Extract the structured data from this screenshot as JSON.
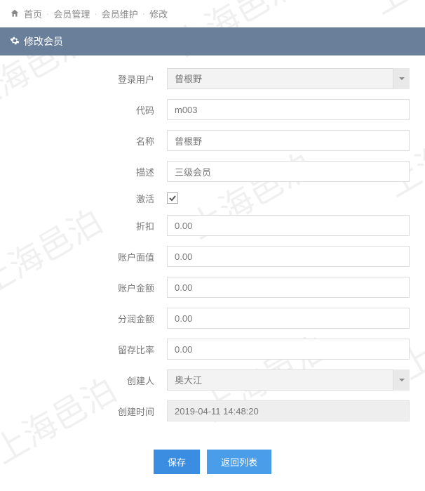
{
  "watermark_text": "上海邑泊",
  "breadcrumb": {
    "home": "首页",
    "level1": "会员管理",
    "level2": "会员维护",
    "current": "修改"
  },
  "panel": {
    "title": "修改会员"
  },
  "form": {
    "login_user": {
      "label": "登录用户",
      "value": "曾根野"
    },
    "code": {
      "label": "代码",
      "value": "m003"
    },
    "name": {
      "label": "名称",
      "value": "曾根野"
    },
    "desc": {
      "label": "描述",
      "value": "三级会员"
    },
    "active": {
      "label": "激活",
      "checked": true
    },
    "discount": {
      "label": "折扣",
      "value": "0.00"
    },
    "face_value": {
      "label": "账户面值",
      "value": "0.00"
    },
    "balance": {
      "label": "账户金额",
      "value": "0.00"
    },
    "dividend": {
      "label": "分润金额",
      "value": "0.00"
    },
    "retention": {
      "label": "留存比率",
      "value": "0.00"
    },
    "creator": {
      "label": "创建人",
      "value": "奥大江"
    },
    "created_at": {
      "label": "创建时间",
      "value": "2019-04-11 14:48:20"
    }
  },
  "actions": {
    "save": "保存",
    "back": "返回列表"
  }
}
